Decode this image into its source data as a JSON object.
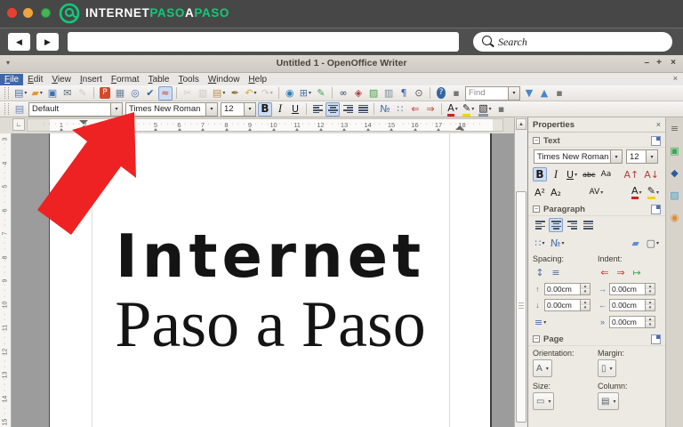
{
  "ui": {
    "dropdown_glyph": "▾",
    "up_glyph": "▴",
    "down_glyph": "▾",
    "back_glyph": "◀",
    "forward_glyph": "▶",
    "collapse_glyph": "−",
    "scroll_up_glyph": "▲",
    "corner_glyph": "∟"
  },
  "colors": {
    "brand_green": "#12c979",
    "arrow_red": "#ee2222",
    "accent_blue": "#3f68a8",
    "active_bg": "#cfdcf0",
    "brand_bar": "#474747"
  },
  "brand": {
    "word1": "INTERNET",
    "word2": "PASO",
    "word3": "A",
    "word4": "PASO",
    "search_placeholder": "Search"
  },
  "window": {
    "title": "Untitled 1 - OpenOffice Writer",
    "menu_arrow": "▾",
    "minimize": "–",
    "maximize": "+",
    "close": "×",
    "doc_close": "×"
  },
  "menus": [
    {
      "label": "File",
      "active": true
    },
    {
      "label": "Edit"
    },
    {
      "label": "View"
    },
    {
      "label": "Insert"
    },
    {
      "label": "Format"
    },
    {
      "label": "Table"
    },
    {
      "label": "Tools"
    },
    {
      "label": "Window"
    },
    {
      "label": "Help"
    }
  ],
  "standard_toolbar": [
    {
      "t": "grip",
      "name": "std-toolbar-grip"
    },
    {
      "t": "icon",
      "name": "new-document-button",
      "g": "▤",
      "fg": "#4a70a8",
      "dd": 1
    },
    {
      "t": "icon",
      "name": "open-button",
      "g": "▰",
      "fg": "#e8962e",
      "dd": 1
    },
    {
      "t": "icon",
      "name": "save-button",
      "g": "▣",
      "fg": "#3f6fb4"
    },
    {
      "t": "icon",
      "name": "email-document-button",
      "g": "✉",
      "fg": "#5a6b7a"
    },
    {
      "t": "icon",
      "name": "edit-file-button",
      "g": "✎",
      "fg": "#9b978f",
      "dis": 1
    },
    {
      "t": "sep"
    },
    {
      "t": "icon",
      "name": "export-pdf-button",
      "g": "P",
      "fg": "#ffffff",
      "bg": "#d6492f"
    },
    {
      "t": "icon",
      "name": "print-button",
      "g": "▦",
      "fg": "#6e7f96"
    },
    {
      "t": "icon",
      "name": "page-preview-button",
      "g": "◎",
      "fg": "#4a70a8"
    },
    {
      "t": "icon",
      "name": "spellcheck-button",
      "g": "✔",
      "fg": "#3465a4"
    },
    {
      "t": "icon",
      "name": "autospellcheck-button",
      "g": "≈",
      "fg": "#c0392b",
      "act": 1
    },
    {
      "t": "sep"
    },
    {
      "t": "icon",
      "name": "cut-button",
      "g": "✂",
      "fg": "#9b978f",
      "dis": 1
    },
    {
      "t": "icon",
      "name": "copy-button",
      "g": "▥",
      "fg": "#9b978f",
      "dis": 1
    },
    {
      "t": "icon",
      "name": "paste-button",
      "g": "▤",
      "fg": "#b98f4e",
      "dd": 1
    },
    {
      "t": "icon",
      "name": "format-paintbrush-button",
      "g": "✒",
      "fg": "#8a6d3b"
    },
    {
      "t": "icon",
      "name": "undo-button",
      "g": "↶",
      "fg": "#d9a62e",
      "dd": 1
    },
    {
      "t": "icon",
      "name": "redo-button",
      "g": "↷",
      "fg": "#9b978f",
      "dis": 1,
      "dd": 1
    },
    {
      "t": "sep"
    },
    {
      "t": "icon",
      "name": "hyperlink-button",
      "g": "◉",
      "fg": "#2e7dbe"
    },
    {
      "t": "icon",
      "name": "insert-table-button",
      "g": "⊞",
      "fg": "#4a70a8",
      "dd": 1
    },
    {
      "t": "icon",
      "name": "draw-functions-button",
      "g": "✎",
      "fg": "#3aa655"
    },
    {
      "t": "sep"
    },
    {
      "t": "icon",
      "name": "find-replace-button",
      "g": "∞",
      "fg": "#2c3e66"
    },
    {
      "t": "icon",
      "name": "navigator-button",
      "g": "◈",
      "fg": "#b0413e"
    },
    {
      "t": "icon",
      "name": "gallery-button",
      "g": "▨",
      "fg": "#4a9e4a"
    },
    {
      "t": "icon",
      "name": "data-sources-button",
      "g": "▥",
      "fg": "#7a8a99"
    },
    {
      "t": "icon",
      "name": "formatting-marks-button",
      "g": "¶",
      "fg": "#3465a4"
    },
    {
      "t": "icon",
      "name": "zoom-button",
      "g": "⊙",
      "fg": "#555555"
    },
    {
      "t": "sep"
    },
    {
      "t": "icon",
      "name": "help-button",
      "g": "?",
      "fg": "#ffffff",
      "bg": "#3465a4",
      "round": 1
    },
    {
      "t": "icon",
      "name": "toolbar-options-button",
      "g": "▪",
      "fg": "#777777"
    },
    {
      "t": "combo",
      "name": "find-input",
      "v": "Find",
      "w": 62,
      "ph": 1
    },
    {
      "t": "icon",
      "name": "find-next-button",
      "g": "▼",
      "fg": "#4a86c8"
    },
    {
      "t": "icon",
      "name": "find-previous-button",
      "g": "▲",
      "fg": "#4a86c8"
    },
    {
      "t": "icon",
      "name": "std-overflow-button",
      "g": "▪",
      "fg": "#777777"
    }
  ],
  "format_toolbar": [
    {
      "t": "grip",
      "name": "fmt-toolbar-grip"
    },
    {
      "t": "icon",
      "name": "styles-panel-button",
      "g": "▤",
      "fg": "#6b86b8"
    },
    {
      "t": "combo",
      "name": "paragraph-style-combo",
      "v": "Default",
      "w": 106
    },
    {
      "t": "combo",
      "name": "font-name-combo",
      "v": "Times New Roman",
      "w": 104
    },
    {
      "t": "combo",
      "name": "font-size-combo",
      "v": "12",
      "w": 40
    },
    {
      "t": "icon",
      "name": "bold-button",
      "g": "B",
      "cls": "gB",
      "act": 1
    },
    {
      "t": "icon",
      "name": "italic-button",
      "g": "I",
      "cls": "gI"
    },
    {
      "t": "icon",
      "name": "underline-button",
      "g": "U",
      "cls": "gU"
    },
    {
      "t": "sep"
    },
    {
      "t": "align",
      "name": "align-left-button",
      "dir": "left"
    },
    {
      "t": "align",
      "name": "align-center-button",
      "dir": "center",
      "act": 1
    },
    {
      "t": "align",
      "name": "align-right-button",
      "dir": "right"
    },
    {
      "t": "align",
      "name": "justify-button",
      "dir": "justify"
    },
    {
      "t": "sep"
    },
    {
      "t": "icon",
      "name": "numbering-button",
      "g": "№",
      "fg": "#4a70a8"
    },
    {
      "t": "icon",
      "name": "bullets-button",
      "g": "∷",
      "fg": "#4a70a8"
    },
    {
      "t": "icon",
      "name": "decrease-indent-button",
      "g": "⇐",
      "fg": "#c0392b"
    },
    {
      "t": "icon",
      "name": "increase-indent-button",
      "g": "⇒",
      "fg": "#c0392b"
    },
    {
      "t": "sep"
    },
    {
      "t": "icon",
      "name": "font-color-button",
      "g": "A",
      "fg": "#1b1b1b",
      "bar": "#cc2222",
      "dd": 1
    },
    {
      "t": "icon",
      "name": "highlighting-button",
      "g": "✎",
      "fg": "#1b1b1b",
      "bar": "#f2d500",
      "dd": 1
    },
    {
      "t": "icon",
      "name": "background-color-button",
      "g": "▧",
      "fg": "#1b1b1b",
      "bar": "#8a97a8",
      "dd": 1
    },
    {
      "t": "icon",
      "name": "fmt-overflow-button",
      "g": "▪",
      "fg": "#777777"
    }
  ],
  "ruler": {
    "h_numbers": [
      1,
      2,
      3,
      4,
      5,
      6,
      7,
      8,
      9,
      10,
      11,
      12,
      13,
      14,
      15,
      16,
      17,
      18
    ],
    "v_numbers": [
      3,
      4,
      5,
      6,
      7,
      8,
      9,
      10,
      11,
      12,
      13,
      14,
      15
    ]
  },
  "document": {
    "line1": "Internet",
    "line2": "Paso a Paso"
  },
  "sidebar": {
    "title": "Properties",
    "close_glyph": "×",
    "collapse_glyph": "−",
    "text": {
      "label": "Text",
      "font_name": "Times New Roman",
      "font_size": "12",
      "row1": [
        {
          "t": "icon",
          "name": "sb-bold-button",
          "g": "B",
          "cls": "gB",
          "act": 1
        },
        {
          "t": "icon",
          "name": "sb-italic-button",
          "g": "I",
          "cls": "gI"
        },
        {
          "t": "icon",
          "name": "sb-underline-button",
          "g": "U",
          "cls": "gU",
          "dd": 1
        },
        {
          "t": "icon",
          "name": "sb-strikethrough-button",
          "g": "abc",
          "cls": "gS"
        },
        {
          "t": "icon",
          "name": "sb-character-dialog-button",
          "g": "Aa",
          "cls": "gAa"
        },
        {
          "t": "gap"
        },
        {
          "t": "icon",
          "name": "increase-font-button",
          "g": "A↑",
          "fg": "#b0413e"
        },
        {
          "t": "icon",
          "name": "decrease-font-button",
          "g": "A↓",
          "fg": "#b0413e"
        }
      ],
      "row2": [
        {
          "t": "icon",
          "name": "superscript-button",
          "g": "A²",
          "fg": "#1b1b1b"
        },
        {
          "t": "icon",
          "name": "subscript-button",
          "g": "A₂",
          "fg": "#1b1b1b"
        },
        {
          "t": "gap"
        },
        {
          "t": "icon",
          "name": "character-spacing-button",
          "g": "AV",
          "cls": "gAa",
          "dd": 1
        },
        {
          "t": "gap"
        },
        {
          "t": "icon",
          "name": "sb-font-color-button",
          "g": "A",
          "fg": "#1b1b1b",
          "bar": "#cc2222",
          "dd": 1
        },
        {
          "t": "icon",
          "name": "sb-highlighting-button",
          "g": "✎",
          "fg": "#1b1b1b",
          "bar": "#f2d500",
          "dd": 1
        }
      ]
    },
    "paragraph": {
      "label": "Paragraph",
      "spacing_label": "Spacing:",
      "indent_label": "Indent:",
      "align": [
        {
          "t": "align",
          "name": "sb-align-left-button",
          "dir": "left"
        },
        {
          "t": "align",
          "name": "sb-align-center-button",
          "dir": "center",
          "act": 1
        },
        {
          "t": "align",
          "name": "sb-align-right-button",
          "dir": "right"
        },
        {
          "t": "align",
          "name": "sb-justify-button",
          "dir": "justify"
        }
      ],
      "lists": [
        {
          "t": "icon",
          "name": "sb-bullets-button",
          "g": "∷",
          "fg": "#4a70a8",
          "dd": 1
        },
        {
          "t": "icon",
          "name": "sb-numbering-button",
          "g": "№",
          "fg": "#4a70a8",
          "dd": 1
        },
        {
          "t": "gap"
        },
        {
          "t": "icon",
          "name": "area-fill-button",
          "g": "▰",
          "fg": "#5b8dd6"
        },
        {
          "t": "icon",
          "name": "border-button",
          "g": "▢",
          "fg": "#55606e",
          "dd": 1
        }
      ],
      "spacing_icons": [
        {
          "t": "icon",
          "name": "increase-spacing-button",
          "g": "↕",
          "fg": "#4a70a8"
        },
        {
          "t": "icon",
          "name": "decrease-spacing-button",
          "g": "≡",
          "fg": "#4a70a8"
        }
      ],
      "indent_icons": [
        {
          "t": "icon",
          "name": "sb-decrease-indent-button",
          "g": "⇐",
          "fg": "#c0392b"
        },
        {
          "t": "icon",
          "name": "sb-increase-indent-button",
          "g": "⇒",
          "fg": "#c0392b"
        },
        {
          "t": "icon",
          "name": "hanging-indent-button",
          "g": "↦",
          "fg": "#3aa655"
        }
      ],
      "linespacing": [
        {
          "t": "icon",
          "name": "line-spacing-button",
          "g": "≡",
          "fg": "#4a70a8",
          "dd": 1
        }
      ],
      "icons": {
        "above": "↑",
        "below": "↓",
        "before": "→",
        "after": "←",
        "first": "»"
      },
      "fields": {
        "above": "0.00cm",
        "below": "0.00cm",
        "before": "0.00cm",
        "after": "0.00cm",
        "first_line": "0.00cm"
      }
    },
    "page": {
      "label": "Page",
      "orientation_label": "Orientation:",
      "margin_label": "Margin:",
      "size_label": "Size:",
      "column_label": "Column:",
      "orientation_glyph": "A",
      "margin_glyph": "▯",
      "size_glyph": "▭",
      "column_glyph": "▤"
    }
  },
  "tabstrip": [
    {
      "t": "icon",
      "name": "sidebar-menu-button",
      "g": "≡",
      "fg": "#6b6761"
    },
    {
      "t": "icon",
      "name": "tab-properties",
      "g": "▣",
      "fg": "#3aa655"
    },
    {
      "t": "icon",
      "name": "tab-styles",
      "g": "◆",
      "fg": "#2c5aa0"
    },
    {
      "t": "icon",
      "name": "tab-gallery",
      "g": "▨",
      "fg": "#4aa0c8"
    },
    {
      "t": "icon",
      "name": "tab-navigator",
      "g": "◉",
      "fg": "#e08a2e"
    }
  ]
}
